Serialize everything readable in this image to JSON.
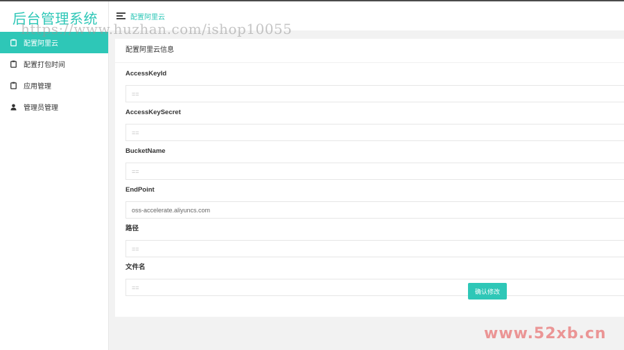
{
  "brand": {
    "title": "后台管理系统"
  },
  "sidebar": {
    "items": [
      {
        "label": "配置阿里云",
        "icon": "clipboard-icon",
        "active": true
      },
      {
        "label": "配置打包时间",
        "icon": "clipboard-icon",
        "active": false
      },
      {
        "label": "应用管理",
        "icon": "clipboard-icon",
        "active": false
      },
      {
        "label": "管理员管理",
        "icon": "user-icon",
        "active": false
      }
    ]
  },
  "header": {
    "breadcrumb": "配置阿里云"
  },
  "card": {
    "title": "配置阿里云信息"
  },
  "form": {
    "fields": [
      {
        "label": "AccessKeyId",
        "value": "",
        "placeholder": "=="
      },
      {
        "label": "AccessKeySecret",
        "value": "",
        "placeholder": "=="
      },
      {
        "label": "BucketName",
        "value": "",
        "placeholder": "=="
      },
      {
        "label": "EndPoint",
        "value": "oss-accelerate.aliyuncs.com",
        "placeholder": ""
      },
      {
        "label": "路径",
        "value": "",
        "placeholder": "=="
      },
      {
        "label": "文件名",
        "value": "",
        "placeholder": "=="
      }
    ],
    "submit_label": "确认修改"
  },
  "watermarks": {
    "url": "https://www.huzhan.com/ishop10055",
    "site": "www.52xb.cn"
  },
  "colors": {
    "accent": "#2ec7b7",
    "background": "#f2f2f2",
    "watermark_site": "#e87070"
  }
}
